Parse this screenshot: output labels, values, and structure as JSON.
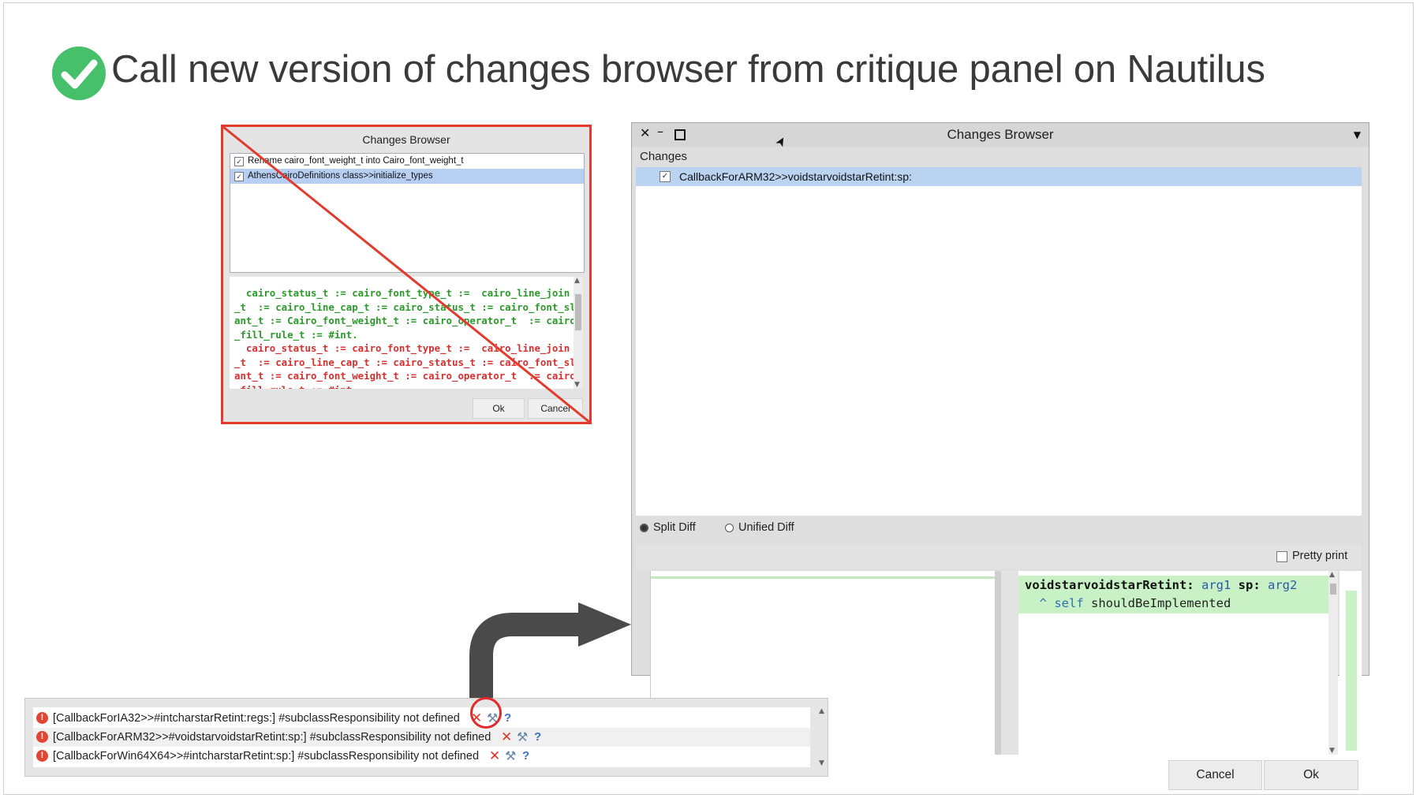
{
  "slide": {
    "title": "Call new version of changes browser from critique panel on Nautilus"
  },
  "colors": {
    "check_green": "#46c06a",
    "strike_red": "#e23b2e",
    "selection_blue": "#b9d3f0",
    "diff_added": "#c8f2c6",
    "arrow_gray": "#4a4a4a"
  },
  "old_browser": {
    "title": "Changes Browser",
    "items": [
      {
        "label": "Rename cairo_font_weight_t into Cairo_font_weight_t",
        "checked": "✓"
      },
      {
        "label": "AthensCairoDefinitions class>>initialize_types",
        "checked": "✓"
      }
    ],
    "code_green": "  cairo_status_t := cairo_font_type_t :=  cairo_line_join\n_t  := cairo_line_cap_t := cairo_status_t := cairo_font_sl\nant_t := Cairo_font_weight_t := cairo_operator_t  := cairo\n_fill_rule_t := #int.",
    "code_red": "  cairo_status_t := cairo_font_type_t :=  cairo_line_join\n_t  := cairo_line_cap_t := cairo_status_t := cairo_font_sl\nant_t := cairo_font_weight_t := cairo_operator_t  := cairo\n_fill_rule_t := #int.",
    "ok_label": "Ok",
    "cancel_label": "Cancel"
  },
  "new_browser": {
    "title": "Changes Browser",
    "close_glyph": "✕",
    "min_glyph": "–",
    "menu_glyph": "▼",
    "cursor_glyph": "➤",
    "changes_label": "Changes",
    "changes": [
      {
        "label": "CallbackForARM32>>voidstarvoidstarRetint:sp:",
        "checked": "✓"
      }
    ],
    "split_diff_label": "Split Diff",
    "unified_diff_label": "Unified Diff",
    "pretty_print_label": "Pretty print",
    "diff_right": {
      "selector": "voidstarvoidstarRetint:",
      "arg1": "arg1",
      "kw2": "sp:",
      "arg2": "arg2",
      "line2_caret": "  ^ ",
      "line2_self": "self",
      "line2_rest": " shouldBeImplemented"
    },
    "cancel_label": "Cancel",
    "ok_label": "Ok"
  },
  "critique_panel": {
    "rows": [
      {
        "text": "[CallbackForIA32>>#intcharstarRetint:regs:] #subclassResponsibility not defined"
      },
      {
        "text": "[CallbackForARM32>>#voidstarvoidstarRetint:sp:] #subclassResponsibility not defined"
      },
      {
        "text": "[CallbackForWin64X64>>#intcharstarRetint:sp:] #subclassResponsibility not defined"
      }
    ],
    "error_glyph": "!",
    "remove_glyph": "✕",
    "tool_glyph": "⚒",
    "help_glyph": "?"
  }
}
